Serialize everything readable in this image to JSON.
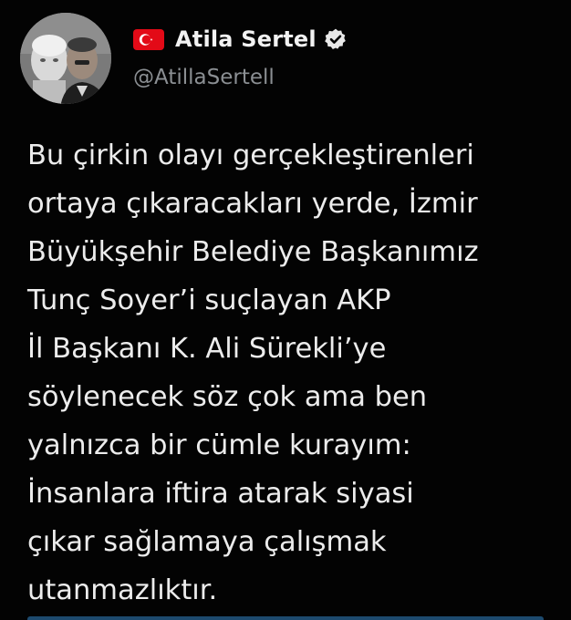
{
  "tweet": {
    "display_name": "Atila Sertel",
    "handle": "@AtillaSertell",
    "flag_icon": "turkey-flag-icon",
    "verified_icon": "verified-badge-icon",
    "text_lines": [
      "Bu çirkin olayı gerçekleştirenleri",
      "ortaya çıkaracakları yerde, İzmir",
      "Büyükşehir Belediye Başkanımız",
      "Tunç Soyer’i suçlayan AKP",
      "İl Başkanı K. Ali Sürekli’ye",
      "söylenecek söz çok ama ben",
      "yalnızca bir cümle kurayım:",
      "İnsanlara iftira atarak siyasi",
      "çıkar sağlamaya çalışmak",
      "utanmazlıktır."
    ]
  },
  "colors": {
    "background": "#030303",
    "text": "#ececec",
    "handle": "#8b8f93",
    "flag_red": "#e30a17"
  }
}
